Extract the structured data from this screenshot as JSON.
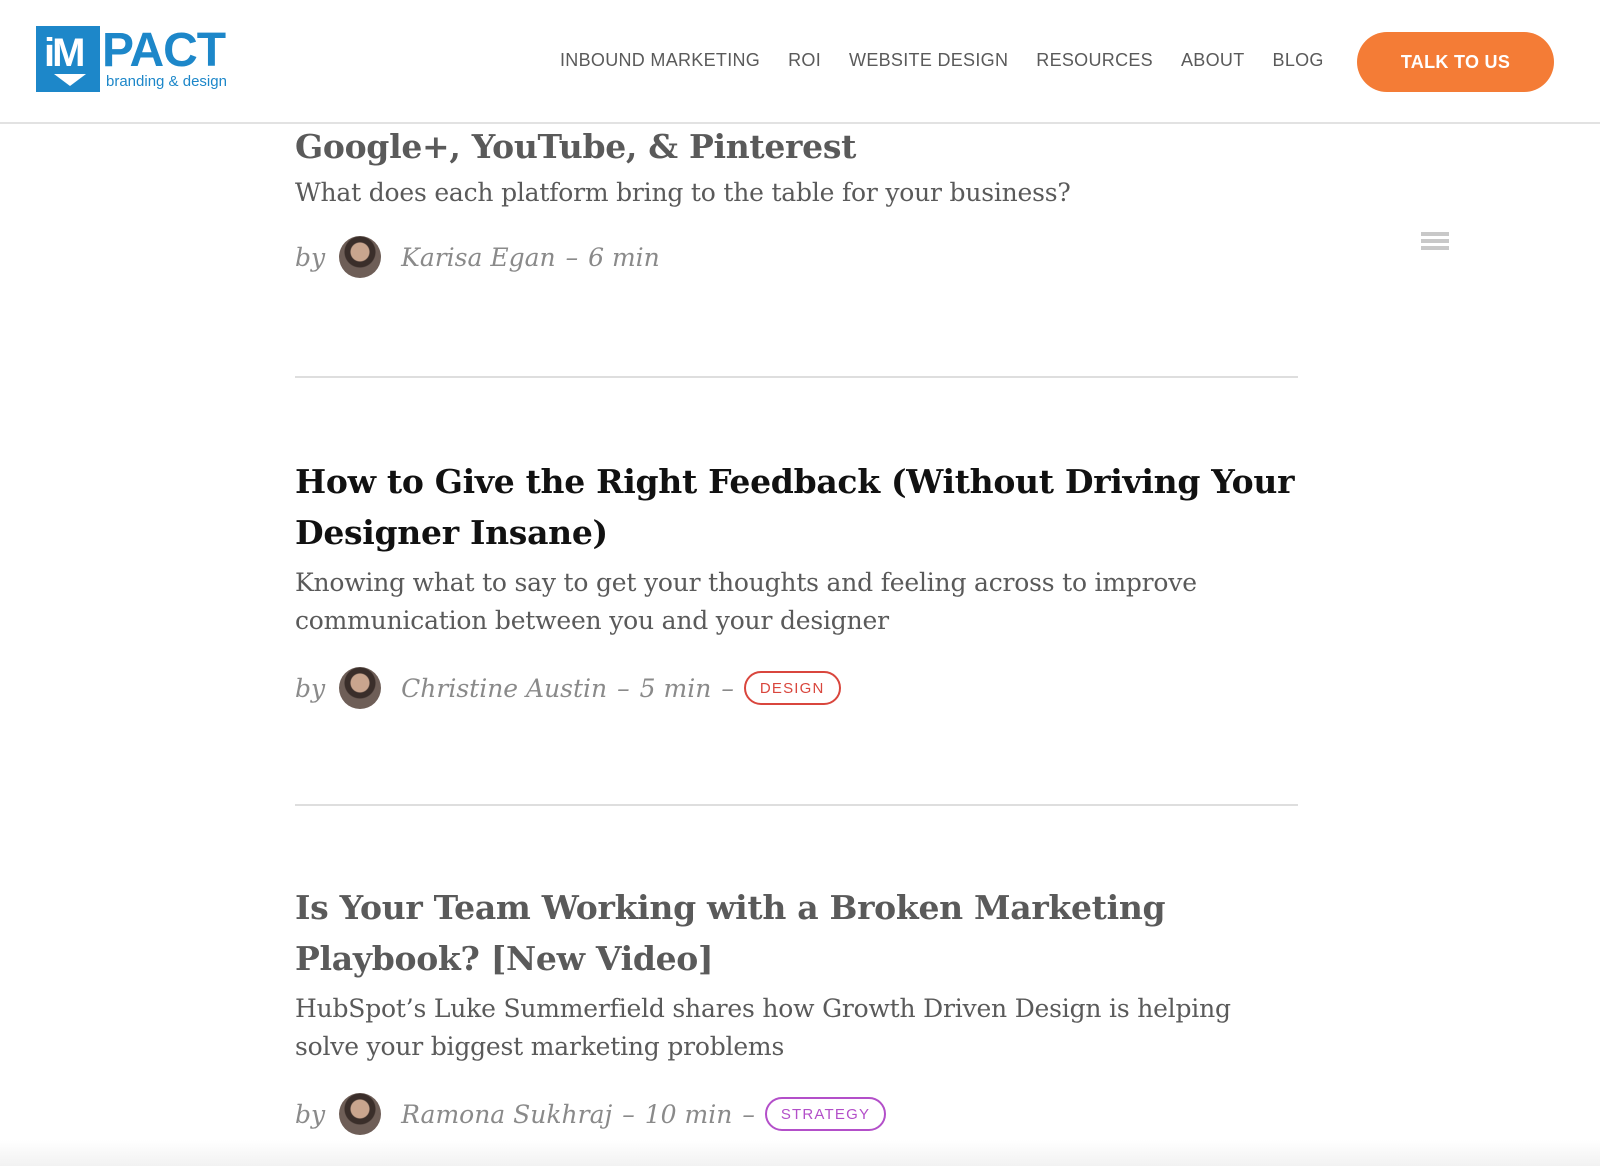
{
  "header": {
    "logo": {
      "word": "PACT",
      "box_letters": "iM",
      "tagline": "branding & design"
    },
    "nav": [
      {
        "label": "INBOUND MARKETING"
      },
      {
        "label": "ROI"
      },
      {
        "label": "WEBSITE DESIGN"
      },
      {
        "label": "RESOURCES"
      },
      {
        "label": "ABOUT"
      },
      {
        "label": "BLOG"
      }
    ],
    "cta_label": "TALK TO US"
  },
  "articles": [
    {
      "title": "Google+, YouTube, & Pinterest",
      "description": "What does each platform bring to the table for your business?",
      "by": "by",
      "author": "Karisa Egan",
      "dash": "–",
      "read_time": "6 min",
      "tag": null
    },
    {
      "title": "How to Give the Right Feedback (Without Driving Your Designer Insane)",
      "description": "Knowing what to say to get your thoughts and feeling across to improve communication between you and your designer",
      "by": "by",
      "author": "Christine Austin",
      "dash": "–",
      "read_time": "5 min",
      "tag": "DESIGN"
    },
    {
      "title": "Is Your Team Working with a Broken Marketing Playbook? [New Video]",
      "description": "HubSpot’s Luke Summerfield shares how Growth Driven Design is helping solve your biggest marketing problems",
      "by": "by",
      "author": "Ramona Sukhraj",
      "dash": "–",
      "read_time": "10 min",
      "tag": "STRATEGY"
    }
  ],
  "colors": {
    "brand_blue": "#1d87c9",
    "cta_orange": "#f47c36",
    "tag_design": "#d9463d",
    "tag_strategy": "#b34fc9"
  },
  "icons": {
    "toc": "menu-lines-icon"
  }
}
